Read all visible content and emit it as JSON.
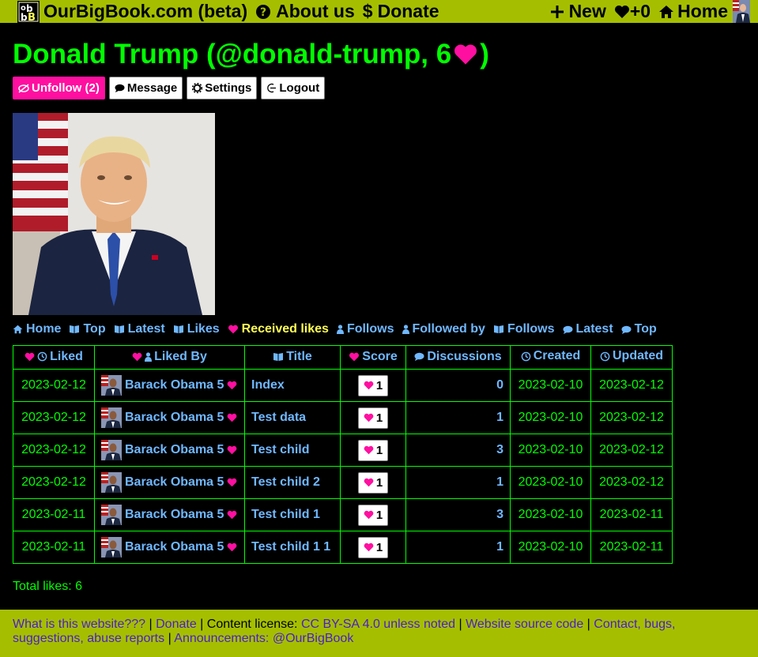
{
  "topbar": {
    "site_name": "OurBigBook.com (beta)",
    "about": "About us",
    "donate": "Donate",
    "new": "New",
    "likes_count": "+0",
    "home": "Home"
  },
  "profile": {
    "title": "Donald Trump (@donald-trump, 6",
    "title_end": ")",
    "buttons": {
      "unfollow": "Unfollow (2)",
      "message": "Message",
      "settings": "Settings",
      "logout": "Logout"
    }
  },
  "tabs": [
    {
      "label": "Home",
      "icon": "home-icon"
    },
    {
      "label": "Top",
      "icon": "book-icon"
    },
    {
      "label": "Latest",
      "icon": "book-icon"
    },
    {
      "label": "Likes",
      "icon": "book-icon"
    },
    {
      "label": "Received likes",
      "icon": "heart-icon",
      "active": true
    },
    {
      "label": "Follows",
      "icon": "user-icon"
    },
    {
      "label": "Followed by",
      "icon": "user-icon"
    },
    {
      "label": "Follows",
      "icon": "book-icon"
    },
    {
      "label": "Latest",
      "icon": "comment-icon"
    },
    {
      "label": "Top",
      "icon": "comment-icon"
    }
  ],
  "table": {
    "headers": {
      "liked": "Liked",
      "liked_by": "Liked By",
      "title": "Title",
      "score": "Score",
      "discussions": "Discussions",
      "created": "Created",
      "updated": "Updated"
    },
    "rows": [
      {
        "liked": "2023-02-12",
        "user": "Barack Obama 5",
        "title": "Index",
        "score": "1",
        "discussions": "0",
        "created": "2023-02-10",
        "updated": "2023-02-12"
      },
      {
        "liked": "2023-02-12",
        "user": "Barack Obama 5",
        "title": "Test data",
        "score": "1",
        "discussions": "1",
        "created": "2023-02-10",
        "updated": "2023-02-12"
      },
      {
        "liked": "2023-02-12",
        "user": "Barack Obama 5",
        "title": "Test child",
        "score": "1",
        "discussions": "3",
        "created": "2023-02-10",
        "updated": "2023-02-12"
      },
      {
        "liked": "2023-02-12",
        "user": "Barack Obama 5",
        "title": "Test child 2",
        "score": "1",
        "discussions": "1",
        "created": "2023-02-10",
        "updated": "2023-02-12"
      },
      {
        "liked": "2023-02-11",
        "user": "Barack Obama 5",
        "title": "Test child 1",
        "score": "1",
        "discussions": "3",
        "created": "2023-02-10",
        "updated": "2023-02-11"
      },
      {
        "liked": "2023-02-11",
        "user": "Barack Obama 5",
        "title": "Test child 1 1",
        "score": "1",
        "discussions": "1",
        "created": "2023-02-10",
        "updated": "2023-02-11"
      }
    ]
  },
  "total_likes": "Total likes: 6",
  "footer": {
    "what": "What is this website???",
    "sep1": " | ",
    "donate": "Donate",
    "sep2": " | Content license: ",
    "license": "CC BY-SA 4.0 unless noted",
    "sep3": " | ",
    "source": "Website source code",
    "sep4": " | ",
    "contact": "Contact, bugs, suggestions, abuse reports",
    "sep5": " | ",
    "announcements": "Announcements: @OurBigBook"
  },
  "colors": {
    "accent_green": "#00ff00",
    "bar": "#a5bf00",
    "link_blue": "#70b8ff",
    "pink": "#ff0fa0"
  }
}
